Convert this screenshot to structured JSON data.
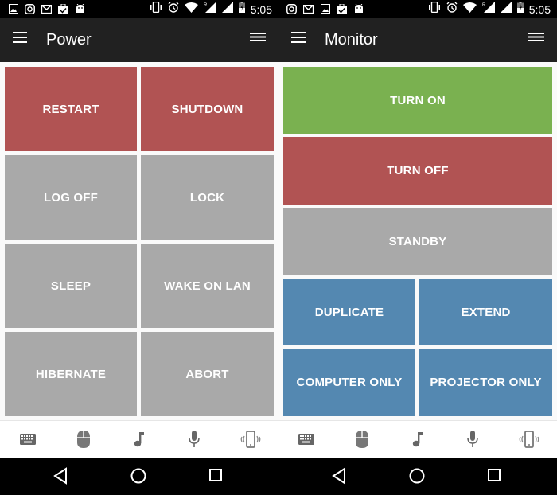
{
  "screens": [
    {
      "status_bar": {
        "notification_icons": [
          "gallery-icon",
          "instagram-icon",
          "gmail-icon",
          "clipboard-check-icon",
          "android-icon"
        ],
        "system_icons": [
          "vibrate-icon",
          "alarm-icon",
          "wifi-icon",
          "signal-roaming-icon",
          "signal-icon",
          "battery-charging-icon"
        ],
        "time": "5:05"
      },
      "app_bar": {
        "title": "Power",
        "nav_icon": "hamburger-icon",
        "menu_icon": "menu-icon"
      },
      "buttons": [
        {
          "label": "RESTART",
          "color": "#b15353"
        },
        {
          "label": "SHUTDOWN",
          "color": "#b15353"
        },
        {
          "label": "LOG OFF",
          "color": "#a9a9a9"
        },
        {
          "label": "LOCK",
          "color": "#a9a9a9"
        },
        {
          "label": "SLEEP",
          "color": "#a9a9a9"
        },
        {
          "label": "WAKE ON LAN",
          "color": "#a9a9a9"
        },
        {
          "label": "HIBERNATE",
          "color": "#a9a9a9"
        },
        {
          "label": "ABORT",
          "color": "#a9a9a9"
        }
      ],
      "bottom_nav": [
        "keyboard-icon",
        "mouse-icon",
        "music-note-icon",
        "microphone-icon",
        "phone-vibrate-icon"
      ],
      "system_nav": [
        "back-icon",
        "home-icon",
        "recents-icon"
      ]
    },
    {
      "status_bar": {
        "notification_icons": [
          "instagram-icon",
          "gmail-icon",
          "gallery-icon",
          "clipboard-check-icon",
          "android-icon"
        ],
        "system_icons": [
          "vibrate-icon",
          "alarm-icon",
          "wifi-icon",
          "signal-roaming-icon",
          "signal-icon",
          "battery-charging-icon"
        ],
        "time": "5:05"
      },
      "app_bar": {
        "title": "Monitor",
        "nav_icon": "hamburger-icon",
        "menu_icon": "menu-icon"
      },
      "buttons": [
        {
          "label": "TURN ON",
          "color": "#7ab150"
        },
        {
          "label": "TURN OFF",
          "color": "#b15353"
        },
        {
          "label": "STANDBY",
          "color": "#a9a9a9"
        },
        {
          "label": "DUPLICATE",
          "color": "#5488b1"
        },
        {
          "label": "EXTEND",
          "color": "#5488b1"
        },
        {
          "label": "COMPUTER ONLY",
          "color": "#5488b1"
        },
        {
          "label": "PROJECTOR ONLY",
          "color": "#5488b1"
        }
      ],
      "bottom_nav": [
        "keyboard-icon",
        "mouse-icon",
        "music-note-icon",
        "microphone-icon",
        "phone-vibrate-icon"
      ],
      "system_nav": [
        "back-icon",
        "home-icon",
        "recents-icon"
      ]
    }
  ],
  "colors": {
    "danger": "#b15353",
    "neutral": "#a9a9a9",
    "success": "#7ab150",
    "info": "#5488b1",
    "app_bar": "#212121"
  }
}
